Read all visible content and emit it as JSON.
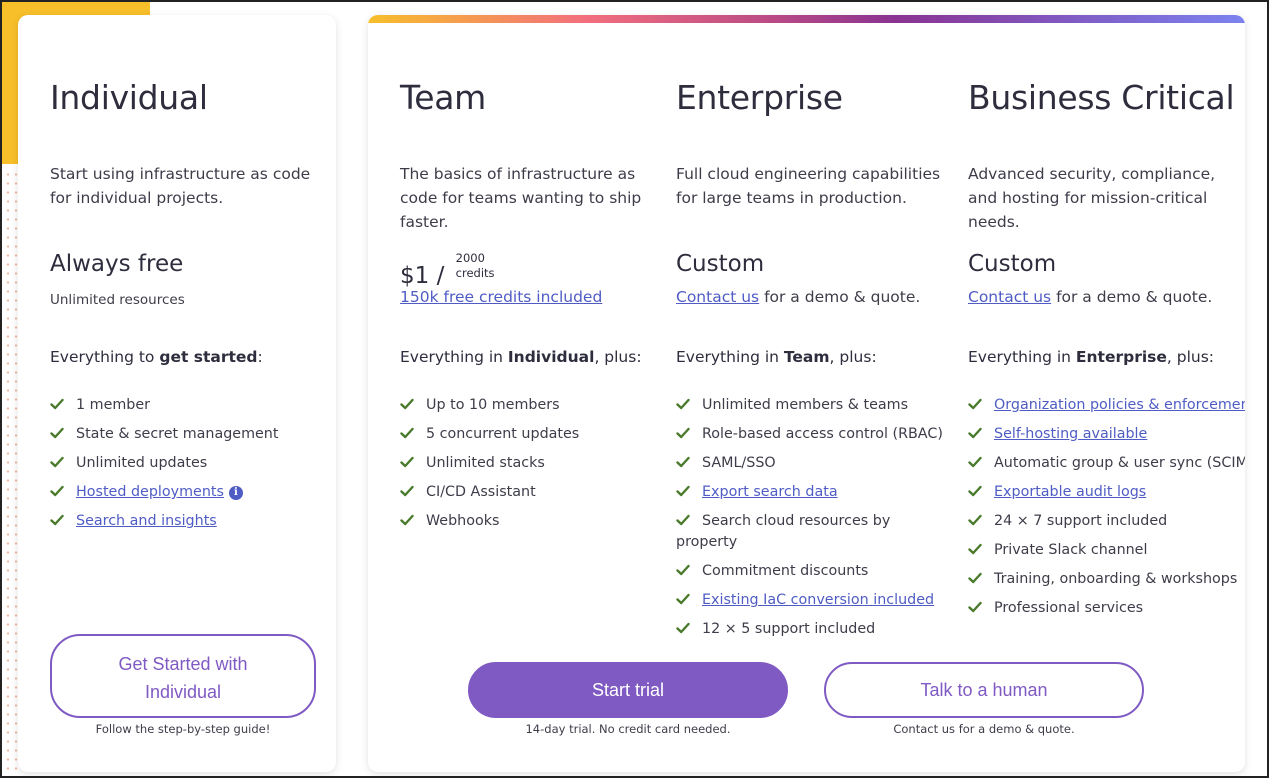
{
  "colors": {
    "accent": "#805ac3",
    "link": "#4f5cc4",
    "check": "#4a7a2c",
    "decor_yellow": "#f7bf2a"
  },
  "individual": {
    "title": "Individual",
    "description": "Start using infrastructure as code for individual projects.",
    "price": "Always free",
    "price_sub": "Unlimited resources",
    "everything_prefix": "Everything to ",
    "everything_bold": "get started",
    "everything_suffix": ":",
    "features": [
      {
        "text": "1 member",
        "link": false
      },
      {
        "text": "State & secret management",
        "link": false
      },
      {
        "text": "Unlimited updates",
        "link": false
      },
      {
        "text": "Hosted deployments",
        "link": true,
        "icon": "info-icon"
      },
      {
        "text": "Search and insights",
        "link": true
      }
    ],
    "button_line1": "Get Started with",
    "button_line2": "Individual",
    "button_note": "Follow the step-by-step guide!"
  },
  "team": {
    "title": "Team",
    "description": "The basics of infrastructure as code for teams wanting to ship faster.",
    "price_main": "$1 /",
    "price_top": "2000",
    "price_bottom": "credits",
    "price_link": "150k free credits included",
    "everything_prefix": "Everything in ",
    "everything_bold": "Individual",
    "everything_suffix": ", plus:",
    "features": [
      {
        "text": "Up to 10 members",
        "link": false
      },
      {
        "text": "5 concurrent updates",
        "link": false
      },
      {
        "text": "Unlimited stacks",
        "link": false
      },
      {
        "text": "CI/CD Assistant",
        "link": false
      },
      {
        "text": "Webhooks",
        "link": false
      }
    ]
  },
  "enterprise": {
    "title": "Enterprise",
    "description": "Full cloud engineering capabilities for large teams in production.",
    "price": "Custom",
    "contact_link": "Contact us",
    "contact_suffix": " for a demo & quote.",
    "everything_prefix": "Everything in ",
    "everything_bold": "Team",
    "everything_suffix": ", plus:",
    "features": [
      {
        "text": "Unlimited members & teams",
        "link": false
      },
      {
        "text": "Role-based access control (RBAC)",
        "link": false
      },
      {
        "text": "SAML/SSO",
        "link": false
      },
      {
        "text": "Export search data",
        "link": true
      },
      {
        "text": "Search cloud resources by",
        "text2": "property",
        "link": false
      },
      {
        "text": "Commitment discounts",
        "link": false
      },
      {
        "text": "Existing IaC conversion included",
        "link": true
      },
      {
        "text": "12 × 5 support included",
        "link": false
      }
    ]
  },
  "business": {
    "title": "Business Critical",
    "description": "Advanced security, compliance, and hosting for mission-critical needs.",
    "price": "Custom",
    "contact_link": "Contact us",
    "contact_suffix": " for a demo & quote.",
    "everything_prefix": "Everything in ",
    "everything_bold": "Enterprise",
    "everything_suffix": ", plus:",
    "features": [
      {
        "text": "Organization policies & enforcement",
        "link": true
      },
      {
        "text": "Self-hosting available",
        "link": true
      },
      {
        "text": "Automatic group & user sync (SCIM)",
        "link": false
      },
      {
        "text": "Exportable audit logs",
        "link": true
      },
      {
        "text": "24 × 7 support included",
        "link": false
      },
      {
        "text": "Private Slack channel",
        "link": false
      },
      {
        "text": "Training, onboarding & workshops",
        "link": false
      },
      {
        "text": "Professional services",
        "link": false
      }
    ]
  },
  "cta": {
    "start_trial": "Start trial",
    "start_trial_note": "14-day trial. No credit card needed.",
    "talk_human": "Talk to a human",
    "talk_human_note": "Contact us for a demo & quote."
  }
}
